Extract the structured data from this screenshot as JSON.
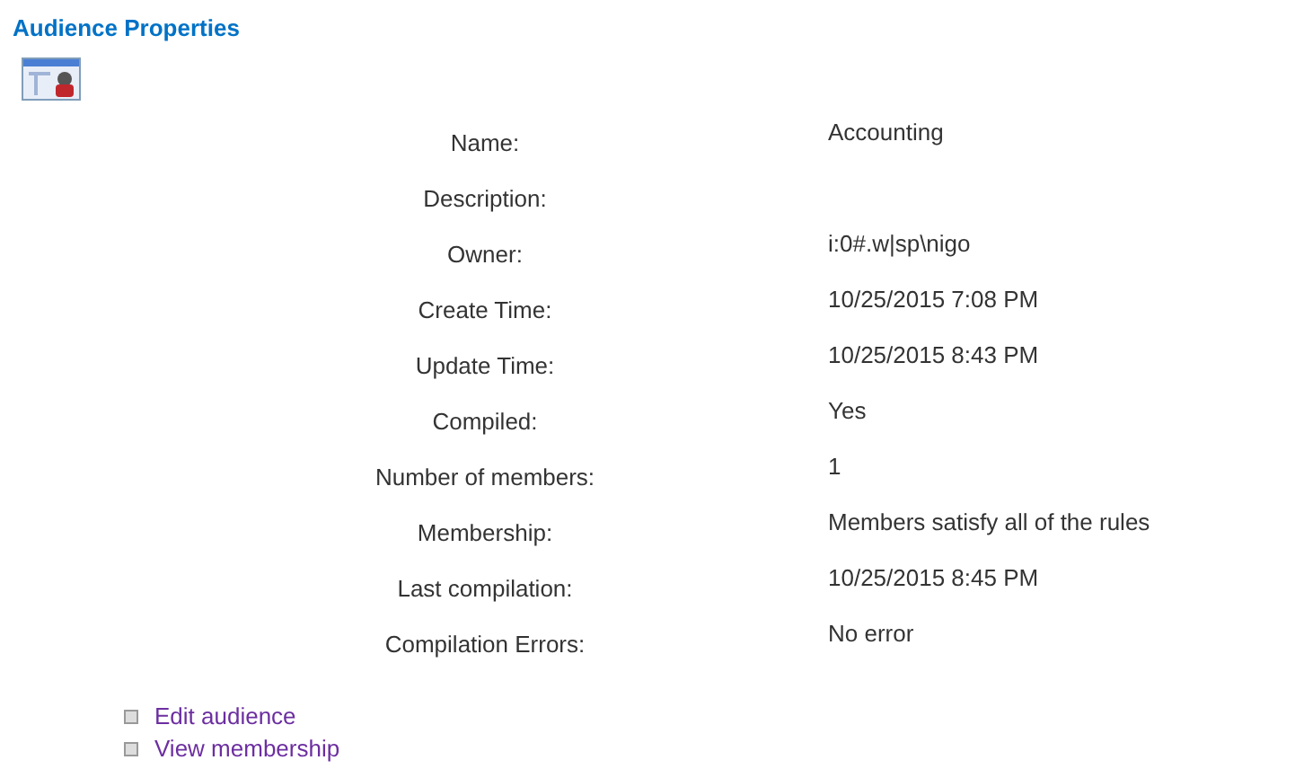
{
  "title": "Audience Properties",
  "properties": [
    {
      "label": "Name:",
      "value": "Accounting"
    },
    {
      "label": "Description:"
    },
    {
      "label": "Owner:",
      "value": "i:0#.w|sp\\nigo"
    },
    {
      "label": "Create Time:",
      "value": "10/25/2015 7:08 PM"
    },
    {
      "label": "Update Time:",
      "value": "10/25/2015 8:43 PM"
    },
    {
      "label": "Compiled:",
      "value": "Yes"
    },
    {
      "label": "Number of members:",
      "value": "1"
    },
    {
      "label": "Membership:",
      "value": "Members satisfy all of the rules"
    },
    {
      "label": "Last compilation:",
      "value": "10/25/2015 8:45 PM"
    },
    {
      "label": "Compilation Errors:",
      "value": "No error"
    }
  ],
  "links": [
    "Edit audience",
    "View membership"
  ]
}
